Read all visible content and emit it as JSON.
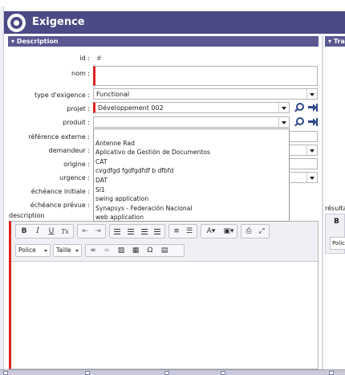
{
  "window": {
    "title": "Exigence"
  },
  "sections": {
    "left": "Description",
    "right": "Tra"
  },
  "form": {
    "id": {
      "label": "id :",
      "value": "#"
    },
    "nom": {
      "label": "nom :",
      "value": ""
    },
    "type": {
      "label": "type d'exigence :",
      "value": "Functional"
    },
    "projet": {
      "label": "projet :",
      "value": "Développement 002"
    },
    "produit": {
      "label": "produit :",
      "value": ""
    },
    "reference": {
      "label": "référence externe :"
    },
    "demandeur": {
      "label": "demandeur :"
    },
    "origine": {
      "label": "origine :"
    },
    "urgence": {
      "label": "urgence :"
    },
    "echeance_initiale": {
      "label": "échéance initiale :"
    },
    "echeance_prevue": {
      "label": "échéance prévue :"
    }
  },
  "produit_options": [
    "",
    "Antenne Rad",
    "Aplicativo de Gestión de Documentos",
    "CAT",
    "cvgdfgd fgdfgdfdf b dfbfd",
    "DAT",
    "SI1",
    "swing application",
    "Synapsys - Federación Nacional",
    "web application"
  ],
  "editor": {
    "label": "description",
    "police": "Police",
    "taille": "Taille"
  },
  "right_panel": {
    "resultat_label": "résulta",
    "bold": "B",
    "police": "Polic"
  },
  "toolbar_glyphs": {
    "bold": "B",
    "italic": "I",
    "underline": "U",
    "clear": "Tx",
    "omega": "Ω"
  }
}
